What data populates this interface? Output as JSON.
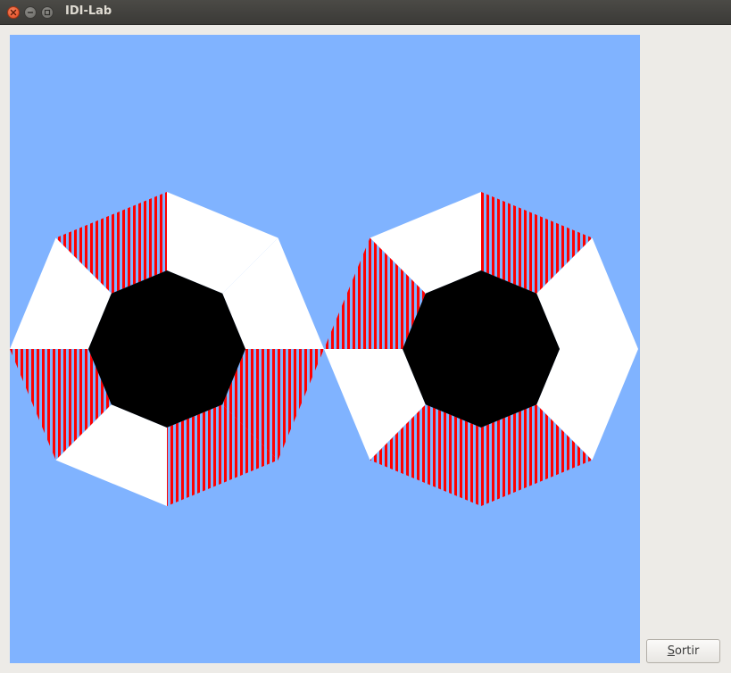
{
  "window": {
    "title": "IDI-Lab"
  },
  "canvas": {
    "background_color": "#80b3ff",
    "hub_color": "#000000",
    "white_color": "#ffffff",
    "stripe_colors": [
      "#ff0000",
      "#80b3ff"
    ],
    "shapes": [
      {
        "name": "left-octagon",
        "white_segments": [
          0,
          1,
          3,
          5
        ],
        "striped_segments": [
          2,
          4,
          6,
          7
        ]
      },
      {
        "name": "right-octagon",
        "white_segments": [
          0,
          2,
          4,
          7
        ],
        "striped_segments": [
          1,
          3,
          5,
          6
        ]
      }
    ]
  },
  "buttons": {
    "exit_mnemonic": "S",
    "exit_rest": "ortir"
  }
}
